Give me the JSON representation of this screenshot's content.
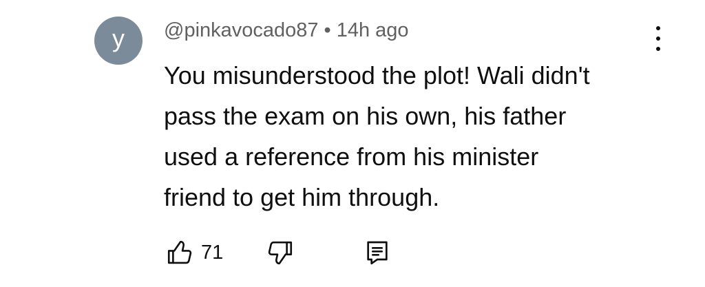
{
  "comment": {
    "avatar_letter": "y",
    "avatar_color": "#7c8b9a",
    "username": "@pinkavocado87",
    "separator": "•",
    "time": "14h ago",
    "text_lines": [
      "You misunderstood the plot! Wali didn't",
      "pass the exam on his own, his father",
      "used a reference from his minister",
      "friend to get him through."
    ],
    "like_count": "71"
  },
  "icons": {
    "menu": "more-vert-icon",
    "like": "thumb-up-icon",
    "dislike": "thumb-down-icon",
    "reply": "reply-comment-icon"
  }
}
